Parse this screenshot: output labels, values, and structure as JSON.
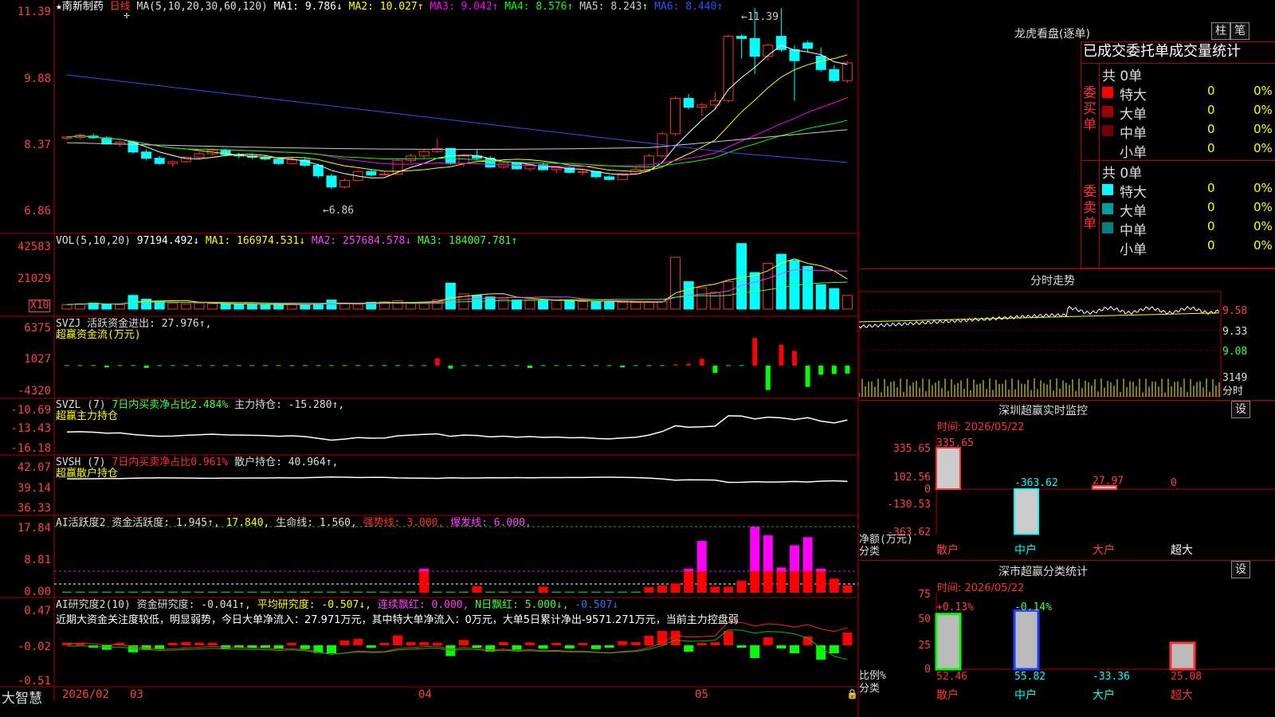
{
  "stock": {
    "name": "★南新制药",
    "period": "日线",
    "ma_title": "MA(5,10,20,30,60,120)",
    "ma_values": [
      {
        "label": "MA1: 9.786↓",
        "color": "#ffffff"
      },
      {
        "label": "MA2: 10.027↑",
        "color": "#ffff00"
      },
      {
        "label": "MA3: 9.042↑",
        "color": "#ff00ff"
      },
      {
        "label": "MA4: 8.576↑",
        "color": "#00ff00"
      },
      {
        "label": "MA5: 8.243↑",
        "color": "#cccccc"
      },
      {
        "label": "MA6: 8.440↑",
        "color": "#3050ff"
      }
    ],
    "high_label": "←11.39",
    "low_label": "←6.86",
    "price_axis": [
      "11.39",
      "9.88",
      "8.37",
      "6.86"
    ],
    "date_axis": [
      "2026/02",
      "03",
      "04",
      "05"
    ],
    "footer_brand": "大智慧"
  },
  "panels": {
    "vol": {
      "title": "VOL(5,10,20)",
      "value": "97194.492↓",
      "ma1": "MA1: 166974.531↓",
      "ma2": "MA2: 257684.578↓",
      "ma3": "MA3: 184007.781↑",
      "axis": [
        "42583",
        "21029"
      ],
      "unit": "X10"
    },
    "svzj": {
      "title": "SVZJ  活跃资金进出: 27.976↑,",
      "sub": "超赢资金流(万元)",
      "axis": [
        "6375",
        "1027",
        "-4320"
      ]
    },
    "svzl": {
      "title": "SVZL (7)",
      "t2": "7日内买卖净占比2.484%",
      "t3": "主力持仓: -15.280↑,",
      "sub": "超赢主力持仓",
      "axis": [
        "-10.69",
        "-13.43",
        "-16.18"
      ]
    },
    "svsh": {
      "title": "SVSH (7)",
      "t2": "7日内买卖净占比0.961%",
      "t3": "散户持仓: 40.964↑,",
      "sub": "超赢散户持仓",
      "axis": [
        "42.07",
        "39.14",
        "36.33"
      ]
    },
    "ai2": {
      "t1": "AI活跃度2 资金活跃度: 1.945↑,",
      "t2": "17.840,",
      "t3": "生命线: 1.560,",
      "t4": "强势线: 3.000,",
      "t5": "爆发线: 6.000,",
      "axis": [
        "17.84",
        "8.81",
        "0.00"
      ]
    },
    "ai_res": {
      "t1": "AI研究度2(10) 资金研究度: -0.041↑,",
      "t2": "平均研究度: -0.507↓,",
      "t3": "连续飘红: 0.000,",
      "t4": "N日飘红: 5.000↓,",
      "t5": "-0.507↓",
      "note": "近期大资金关注度较低，明显弱势，今日大单净流入：27.971万元，其中特大单净流入：0万元，大单5日累计净出-9571.271万元，当前主力控盘弱",
      "axis": [
        "0.47",
        "-0.02",
        "-0.51"
      ]
    }
  },
  "right": {
    "lhb_title": "龙虎看盘(逐单)",
    "btn_zhu": "柱",
    "btn_bi": "笔",
    "tabs_label": "已成交委托单成交量统计",
    "buy_label": "委买单",
    "sell_label": "委卖单",
    "buy_total": "共 0单",
    "sell_total": "共 0单",
    "buy_rows": [
      {
        "name": "特大",
        "count": "0",
        "pct": "0%",
        "color": "#ff0000"
      },
      {
        "name": "大单",
        "count": "0",
        "pct": "0%",
        "color": "#a00000"
      },
      {
        "name": "中单",
        "count": "0",
        "pct": "0%",
        "color": "#700000"
      },
      {
        "name": "小单",
        "count": "0",
        "pct": "0%",
        "color": ""
      }
    ],
    "sell_rows": [
      {
        "name": "特大",
        "count": "0",
        "pct": "0%",
        "color": "#00ffff"
      },
      {
        "name": "大单",
        "count": "0",
        "pct": "0%",
        "color": "#00a0a0"
      },
      {
        "name": "中单",
        "count": "0",
        "pct": "0%",
        "color": "#008080"
      },
      {
        "name": "小单",
        "count": "0",
        "pct": "0%",
        "color": ""
      }
    ],
    "intraday_title": "分时走势",
    "intraday_axis": [
      "9.58",
      "9.33",
      "9.08",
      "3149"
    ],
    "intraday_unit": "分时",
    "monitor_title": "深圳超赢实时监控",
    "monitor_btn": "设",
    "monitor_time": "时间: 2026/05/22",
    "monitor_ylabel": "净额(万元)",
    "monitor_ylabel2": "分类",
    "classify_title": "深市超赢分类统计",
    "classify_btn": "设",
    "classify_time": "时间: 2026/05/22",
    "classify_ylabel": "比例%",
    "classify_ylabel2": "分类"
  },
  "chart_data": [
    {
      "type": "candlestick",
      "title": "南新制药 日线",
      "ylim": [
        6.86,
        11.39
      ],
      "candles": [
        [
          8.45,
          8.5,
          8.4,
          8.48
        ],
        [
          8.47,
          8.55,
          8.42,
          8.52
        ],
        [
          8.5,
          8.56,
          8.44,
          8.46
        ],
        [
          8.46,
          8.5,
          8.3,
          8.32
        ],
        [
          8.32,
          8.4,
          8.25,
          8.36
        ],
        [
          8.36,
          8.4,
          8.1,
          8.14
        ],
        [
          8.14,
          8.2,
          7.95,
          8.0
        ],
        [
          8.0,
          8.05,
          7.85,
          7.88
        ],
        [
          7.88,
          7.95,
          7.8,
          7.92
        ],
        [
          7.92,
          8.05,
          7.9,
          8.02
        ],
        [
          8.02,
          8.15,
          7.98,
          8.1
        ],
        [
          8.1,
          8.2,
          8.05,
          8.18
        ],
        [
          8.18,
          8.22,
          8.05,
          8.08
        ],
        [
          8.08,
          8.12,
          8.0,
          8.05
        ],
        [
          8.05,
          8.1,
          7.98,
          8.02
        ],
        [
          8.02,
          8.06,
          7.95,
          7.98
        ],
        [
          7.98,
          8.02,
          7.85,
          7.88
        ],
        [
          7.88,
          8.0,
          7.85,
          7.96
        ],
        [
          7.96,
          8.0,
          7.8,
          7.84
        ],
        [
          7.84,
          7.88,
          7.55,
          7.6
        ],
        [
          7.6,
          7.65,
          7.3,
          7.35
        ],
        [
          7.35,
          7.55,
          7.32,
          7.5
        ],
        [
          7.5,
          7.72,
          7.48,
          7.7
        ],
        [
          7.7,
          7.74,
          7.58,
          7.62
        ],
        [
          7.62,
          7.7,
          7.6,
          7.64
        ],
        [
          7.64,
          7.98,
          7.62,
          7.95
        ],
        [
          7.95,
          8.1,
          7.9,
          8.05
        ],
        [
          8.05,
          8.2,
          7.98,
          8.15
        ],
        [
          8.15,
          8.45,
          8.12,
          8.22
        ],
        [
          8.22,
          8.24,
          7.85,
          7.88
        ],
        [
          7.88,
          8.08,
          7.8,
          8.05
        ],
        [
          8.05,
          8.2,
          7.95,
          8.0
        ],
        [
          8.0,
          8.05,
          7.78,
          7.8
        ],
        [
          7.8,
          7.92,
          7.76,
          7.9
        ],
        [
          7.9,
          7.92,
          7.74,
          7.76
        ],
        [
          7.76,
          7.88,
          7.7,
          7.85
        ],
        [
          7.85,
          7.9,
          7.72,
          7.74
        ],
        [
          7.74,
          7.8,
          7.65,
          7.78
        ],
        [
          7.78,
          7.8,
          7.66,
          7.68
        ],
        [
          7.68,
          7.75,
          7.62,
          7.7
        ],
        [
          7.7,
          7.72,
          7.55,
          7.58
        ],
        [
          7.58,
          7.62,
          7.5,
          7.52
        ],
        [
          7.52,
          7.68,
          7.5,
          7.65
        ],
        [
          7.65,
          7.8,
          7.62,
          7.75
        ],
        [
          7.75,
          8.1,
          7.72,
          8.05
        ],
        [
          8.05,
          8.6,
          8.0,
          8.55
        ],
        [
          8.55,
          9.4,
          8.5,
          9.35
        ],
        [
          9.35,
          9.45,
          9.1,
          9.15
        ],
        [
          9.15,
          9.25,
          8.95,
          9.2
        ],
        [
          9.2,
          9.5,
          9.1,
          9.3
        ],
        [
          9.3,
          10.8,
          9.25,
          10.75
        ],
        [
          10.75,
          10.8,
          10.25,
          10.7
        ],
        [
          10.7,
          11.39,
          9.9,
          10.3
        ],
        [
          10.3,
          10.6,
          10.2,
          10.55
        ],
        [
          10.75,
          11.39,
          10.4,
          10.45
        ],
        [
          10.45,
          10.55,
          9.3,
          10.2
        ],
        [
          10.6,
          10.65,
          10.4,
          10.48
        ],
        [
          10.3,
          10.5,
          9.95,
          10.0
        ],
        [
          10.0,
          10.1,
          9.7,
          9.75
        ],
        [
          9.75,
          10.2,
          9.7,
          10.15
        ]
      ],
      "ma_series": [
        {
          "name": "MA1",
          "last": 9.786
        },
        {
          "name": "MA2",
          "last": 10.027
        },
        {
          "name": "MA3",
          "last": 9.042
        },
        {
          "name": "MA4",
          "last": 8.576
        },
        {
          "name": "MA5",
          "last": 8.243
        },
        {
          "name": "MA6",
          "last": 8.44
        }
      ]
    },
    {
      "type": "bar",
      "title": "VOL(5,10,20)",
      "ylim": [
        0,
        46000
      ],
      "values": [
        3000,
        3500,
        4000,
        3200,
        3000,
        9000,
        6500,
        5000,
        4000,
        3500,
        3800,
        3600,
        3200,
        3000,
        2800,
        3000,
        3100,
        3000,
        2800,
        3400,
        6000,
        3500,
        3200,
        4500,
        4800,
        5500,
        4000,
        4500,
        6000,
        17000,
        10000,
        9000,
        8000,
        6500,
        6000,
        6000,
        5800,
        5500,
        5200,
        5000,
        4800,
        4600,
        4500,
        4400,
        4600,
        5000,
        34000,
        18000,
        14000,
        11000,
        18000,
        43000,
        24000,
        30000,
        36000,
        32000,
        28000,
        16000,
        13500,
        9000
      ]
    },
    {
      "type": "bar",
      "title": "超赢资金流(万元)",
      "ylim": [
        -4320,
        6375
      ],
      "values": [
        0,
        0,
        0,
        -300,
        0,
        0,
        -400,
        0,
        0,
        0,
        0,
        0,
        0,
        0,
        0,
        0,
        0,
        0,
        0,
        0,
        0,
        0,
        0,
        0,
        0,
        0,
        0,
        0,
        1200,
        -500,
        0,
        0,
        0,
        0,
        0,
        -400,
        0,
        0,
        0,
        0,
        0,
        0,
        -300,
        0,
        0,
        0,
        200,
        300,
        1100,
        -1200,
        0,
        0,
        4500,
        -4000,
        3400,
        2400,
        -3500,
        -1500,
        -1400,
        -1300
      ]
    },
    {
      "type": "bar",
      "title": "AI活跃度2",
      "ylim": [
        0,
        17.84
      ],
      "values": [
        0.3,
        0.3,
        0.3,
        0.3,
        0.3,
        0.3,
        0.3,
        0.3,
        0.3,
        0.3,
        0.3,
        0.3,
        0.3,
        0.3,
        0.3,
        0.3,
        0.3,
        0.3,
        0.3,
        0.3,
        0.3,
        0.3,
        0.3,
        0.3,
        0.3,
        0.3,
        0.3,
        6.5,
        0.3,
        0.3,
        0.3,
        1.8,
        0.3,
        0.3,
        0.3,
        0.3,
        1.6,
        0.3,
        0.3,
        0.3,
        0.3,
        0.3,
        0.3,
        0.3,
        1.5,
        2.0,
        2.5,
        6.5,
        14.0,
        1.6,
        1.6,
        3.2,
        17.8,
        15.5,
        6.8,
        12.8,
        15.0,
        6.5,
        3.8,
        2.0,
        2.2,
        1.9
      ]
    }
  ]
}
